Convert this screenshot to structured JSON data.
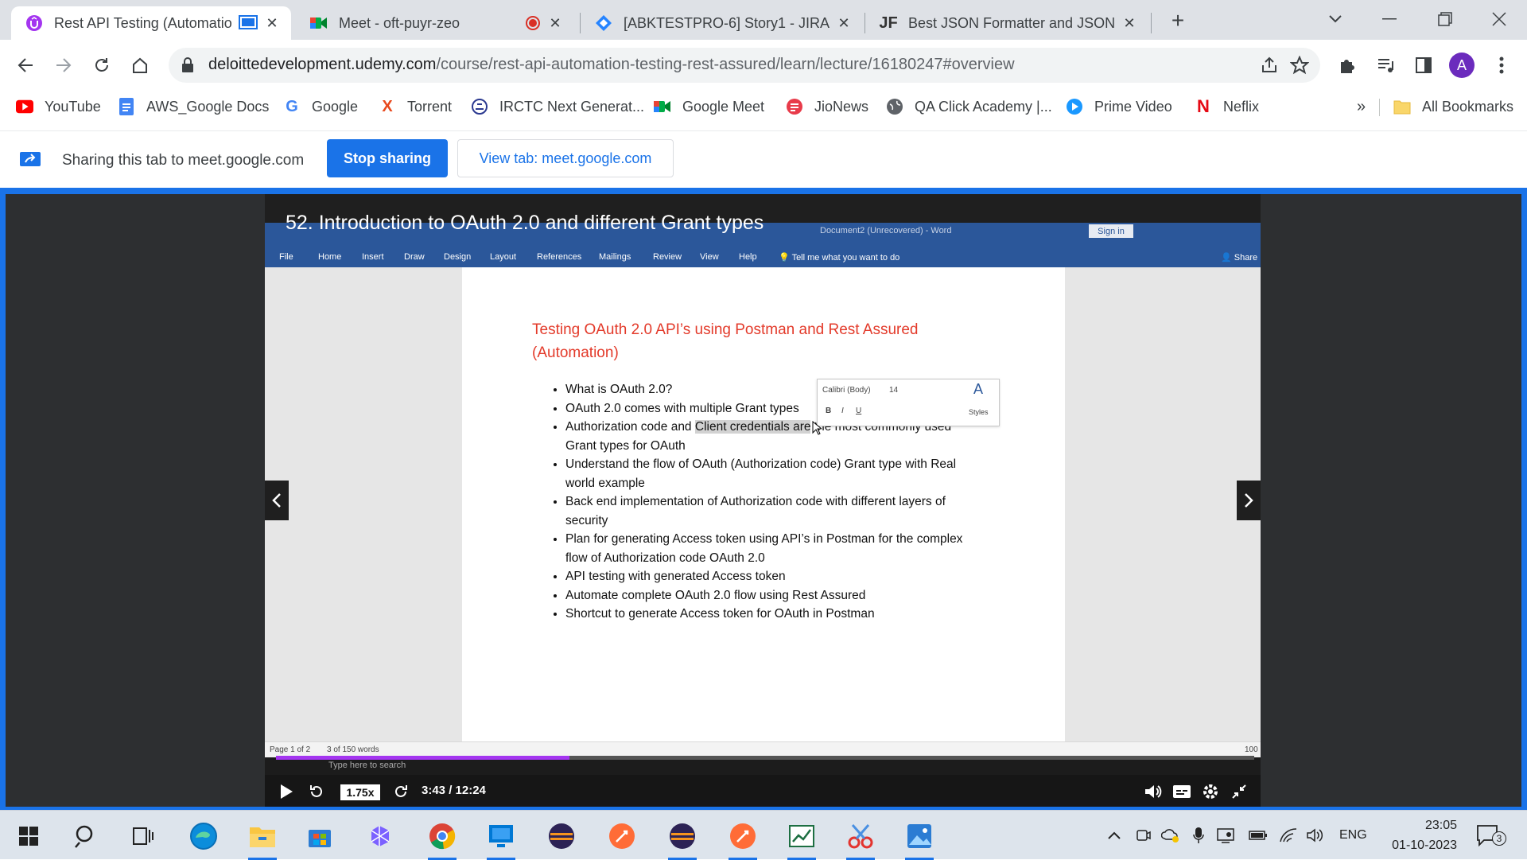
{
  "tabs": [
    {
      "title": "Rest API Testing (Automatio",
      "icon": "udemy-icon"
    },
    {
      "title": "Meet - oft-puyr-zeo",
      "icon": "google-meet-icon"
    },
    {
      "title": "[ABKTESTPRO-6] Story1 - JIRA",
      "icon": "jira-icon"
    },
    {
      "title": "Best JSON Formatter and JSON V",
      "icon": "jsonformatter-icon"
    }
  ],
  "omnibox": {
    "domain": "deloittedevelopment.udemy.com",
    "path": "/course/rest-api-automation-testing-rest-assured/learn/lecture/16180247#overview"
  },
  "profile": {
    "initial": "A",
    "color": "#6b2bbd"
  },
  "bookmarks": [
    {
      "label": "YouTube"
    },
    {
      "label": "AWS_Google Docs"
    },
    {
      "label": "Google"
    },
    {
      "label": "Torrent"
    },
    {
      "label": "IRCTC Next Generat..."
    },
    {
      "label": "Google Meet"
    },
    {
      "label": "JioNews"
    },
    {
      "label": "QA Click Academy |..."
    },
    {
      "label": "Prime Video"
    },
    {
      "label": "Neflix"
    }
  ],
  "bookmarks_overflow": "»",
  "all_bookmarks": "All Bookmarks",
  "sharing": {
    "text": "Sharing this tab to meet.google.com",
    "stop_label": "Stop sharing",
    "view_label": "View tab: meet.google.com"
  },
  "video": {
    "lecture_title": "52. Introduction to OAuth 2.0 and different Grant types",
    "speed": "1.75x",
    "time": "3:43 / 12:24",
    "progress_fraction": 0.3
  },
  "word": {
    "window_title": "Document2 (Unrecovered) - Word",
    "sign_in": "Sign in",
    "share": "Share",
    "ribbon_tabs": [
      "File",
      "Home",
      "Insert",
      "Draw",
      "Design",
      "Layout",
      "References",
      "Mailings",
      "Review",
      "View",
      "Help"
    ],
    "tell_me": "Tell me what you want to do",
    "heading": "Testing OAuth 2.0 API’s using Postman and Rest Assured (Automation)",
    "bullets": [
      "What is OAuth 2.0?",
      "OAuth 2.0 comes with multiple Grant types",
      "Authorization code and Client credentials are the most commonly used Grant types for OAuth",
      "Understand the flow of OAuth (Authorization code) Grant type with Real world example",
      "Back end implementation of Authorization code with different layers of security",
      "Plan for generating Access token using API’s in Postman for the complex flow of Authorization code OAuth 2.0",
      "API testing with generated Access token",
      "Automate complete OAuth 2.0 flow using Rest Assured",
      "Shortcut to generate Access token for OAuth in Postman"
    ],
    "bullet3_parts": {
      "before": "Authorization code and ",
      "highlight": "Client credentials are",
      "after": " the most commonly used Grant types for OAuth"
    },
    "mini_toolbar": {
      "font": "Calibri (Body)",
      "size": "14",
      "styles": "Styles"
    },
    "status": {
      "page": "Page 1 of 2",
      "words": "3 of 150 words",
      "zoom": "100"
    },
    "inner_taskbar_search": "Type here to search"
  },
  "taskbar": {
    "language": "ENG",
    "time": "23:05",
    "date": "01-10-2023",
    "notifications": "3"
  }
}
